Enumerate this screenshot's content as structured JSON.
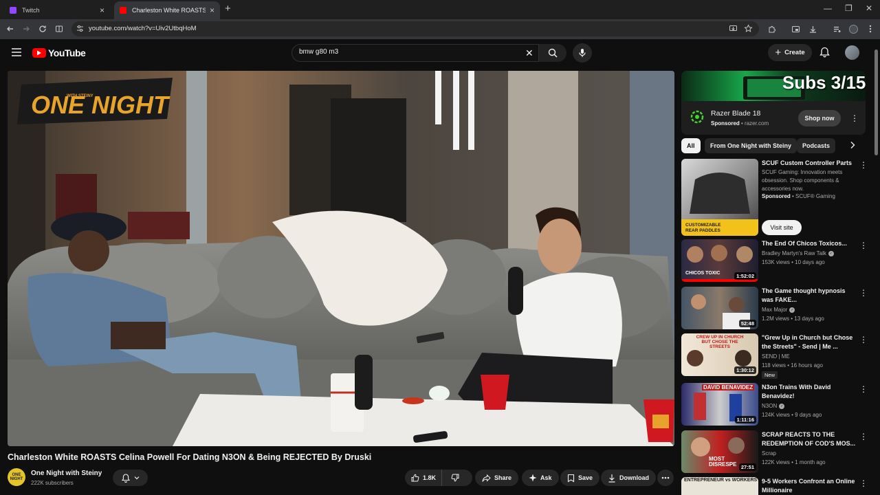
{
  "browser": {
    "tabs": [
      {
        "title": "Twitch",
        "active": false
      },
      {
        "title": "Charleston White ROASTS Celina Powell For Dating N3ON & Being REJECTED By Druski",
        "active": true
      }
    ],
    "url": "youtube.com/watch?v=Uiv2UtbqHoM"
  },
  "header": {
    "logo_text": "YouTube",
    "search_value": "bmw g80 m3",
    "create_label": "Create"
  },
  "video": {
    "title": "Charleston White ROASTS Celina Powell For Dating N3ON & Being REJECTED By Druski",
    "channel": "One Night with Steiny",
    "channel_avatar_text": "ONE NIGHT",
    "subscribers": "222K subscribers",
    "overlay_logo": "ONE NIGHT",
    "overlay_logo_small": "WITH STEINY",
    "likes": "1.8K",
    "actions": {
      "share": "Share",
      "ask": "Ask",
      "save": "Save",
      "download": "Download"
    }
  },
  "ad": {
    "overlay_text": "Subs 3/15",
    "name": "Razer Blade 18",
    "sponsored": "Sponsored",
    "domain": "razer.com",
    "cta": "Shop now"
  },
  "chips": [
    "All",
    "From One Night with Steiny",
    "Podcasts"
  ],
  "recommendations": [
    {
      "title": "SCUF Custom Controller Parts",
      "description": "SCUF Gaming: Innovation meets obsession. Shop components & accessories now.",
      "sponsored": "Sponsored",
      "advertiser": "SCUF® Gaming",
      "cta": "Visit site",
      "thumb_text": "CUSTOMIZABLE REAR PADDLES"
    },
    {
      "title": "The End Of Chicos Toxicos...",
      "channel": "Bradley Martyn's Raw Talk",
      "meta": "153K views • 10 days ago",
      "duration": "1:52:02",
      "thumb_text": "CHICOS TOXIC"
    },
    {
      "title": "The Game thought hypnosis was FAKE...",
      "channel": "Max Major",
      "meta": "1.2M views • 13 days ago",
      "duration": "52:48",
      "thumb_text": ""
    },
    {
      "title": "\"Grew Up in Church but Chose the Streets\" - Send | Me ...",
      "channel": "SEND | ME",
      "meta": "118 views • 16 hours ago",
      "duration": "1:30:12",
      "badge": "New",
      "thumb_text": "CREW UP IN CHURCH BUT CHOSE THE STREETS"
    },
    {
      "title": "N3on Trains With David Benavidez!",
      "channel": "N3ON",
      "meta": "124K views • 9 days ago",
      "duration": "1:11:16",
      "thumb_text": "DAVID BENAVIDEZ"
    },
    {
      "title": "SCRAP REACTS TO THE REDEMPTION OF COD'S MOS...",
      "channel": "Scrap",
      "meta": "122K views • 1 month ago",
      "duration": "27:51",
      "thumb_text": "MOST DISRESPE"
    },
    {
      "title": "9-5 Workers Confront an Online Millionaire",
      "thumb_text": "ENTREPRENEUR vs WORKERS"
    }
  ]
}
